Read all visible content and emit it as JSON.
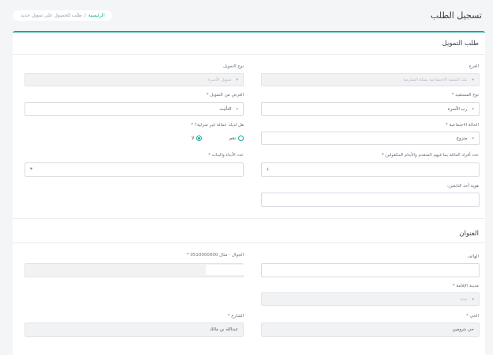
{
  "header": {
    "title": "تسجيل الطلب",
    "breadcrumb_home": "الرئيسية",
    "breadcrumb_sep": "/",
    "breadcrumb_current": "طلب للحصول على تمويل جديد"
  },
  "colors": {
    "accent": "#19a8a0"
  },
  "financing": {
    "title": "طلب التمويل",
    "branch_label": "الفرع",
    "branch_value": "بنك التنمية الاجتماعية بمكة المكرمة",
    "finance_type_label": "نوع التمويل",
    "finance_type_value": "تمويل الأسرة",
    "beneficiary_type_label": "نوع المستفيد *",
    "beneficiary_type_value": "رب الأسرة",
    "purpose_label": "الغرض من التمويل *",
    "purpose_value": "التأثيث",
    "social_status_label": "الحالة الاجتماعية *",
    "social_status_value": "متزوج",
    "domestic_worker_label": "هل لديك عمالة غير منزلية؟ *",
    "radio_yes": "نعم",
    "radio_no": "لا",
    "family_count_label": "عدد أفراد العائلة بما فيهم المتقدم والأيتام المكفولين *",
    "family_count_value": "٤",
    "children_count_label": "عدد الأبناء والبنات *",
    "children_count_value": "٣",
    "dependent_id_label": "هوية أحد التابعين:",
    "dependent_id_value": ""
  },
  "address": {
    "title": "العنوان",
    "phone_label": "الهاتف",
    "phone_value": "",
    "mobile_label": "الجوال - مثال 0510000000 *",
    "mobile_value": "",
    "city_label": "مدينة الإقامة *",
    "city_value": "جدة",
    "district_label": "الحي *",
    "district_value": "حي بترومين",
    "street_label": "الشارع *",
    "street_value": "عبدالله بن مالك"
  }
}
